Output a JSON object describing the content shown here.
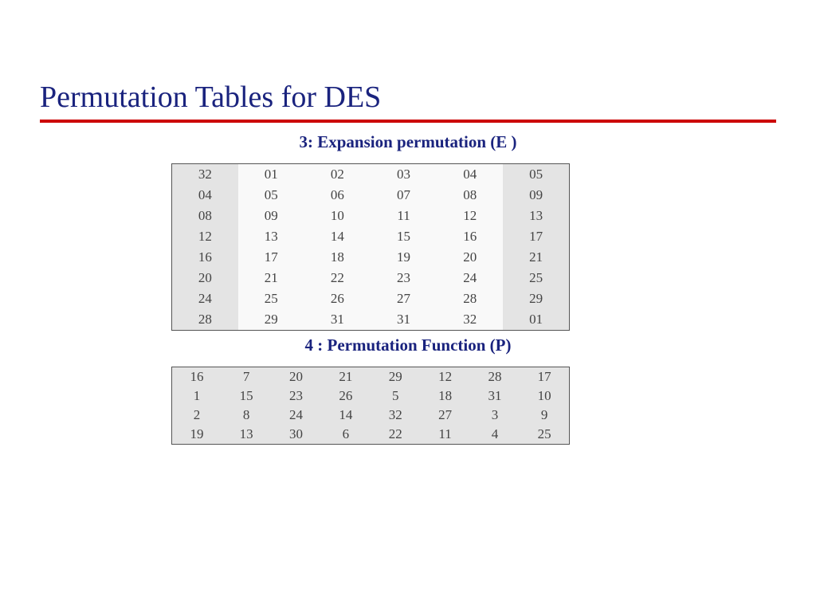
{
  "title": "Permutation Tables for DES",
  "section_e": {
    "heading": "3: Expansion permutation (E )",
    "rows": [
      [
        "32",
        "01",
        "02",
        "03",
        "04",
        "05"
      ],
      [
        "04",
        "05",
        "06",
        "07",
        "08",
        "09"
      ],
      [
        "08",
        "09",
        "10",
        "11",
        "12",
        "13"
      ],
      [
        "12",
        "13",
        "14",
        "15",
        "16",
        "17"
      ],
      [
        "16",
        "17",
        "18",
        "19",
        "20",
        "21"
      ],
      [
        "20",
        "21",
        "22",
        "23",
        "24",
        "25"
      ],
      [
        "24",
        "25",
        "26",
        "27",
        "28",
        "29"
      ],
      [
        "28",
        "29",
        "31",
        "31",
        "32",
        "01"
      ]
    ]
  },
  "section_p": {
    "heading": "4 : Permutation Function  (P)",
    "rows": [
      [
        "16",
        "7",
        "20",
        "21",
        "29",
        "12",
        "28",
        "17"
      ],
      [
        "1",
        "15",
        "23",
        "26",
        "5",
        "18",
        "31",
        "10"
      ],
      [
        "2",
        "8",
        "24",
        "14",
        "32",
        "27",
        "3",
        "9"
      ],
      [
        "19",
        "13",
        "30",
        "6",
        "22",
        "11",
        "4",
        "25"
      ]
    ]
  }
}
